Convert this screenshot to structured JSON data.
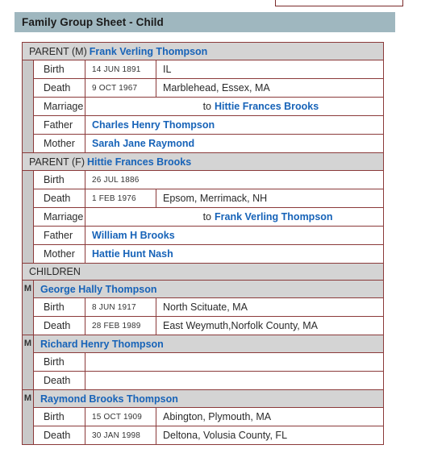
{
  "top_partial_box": {
    "visible": true
  },
  "header": {
    "title": "Family Group Sheet - Child"
  },
  "labels": {
    "birth": "Birth",
    "death": "Death",
    "marriage": "Marriage",
    "father": "Father",
    "mother": "Mother",
    "marriage_to": "to",
    "children_heading": "CHILDREN",
    "gender_male": "M"
  },
  "colors": {
    "title_bar": "#9fb7bf",
    "row_header_gray": "#d4d4d4",
    "gutter_gray": "#c9c9c9",
    "border_red": "#8b3a3a",
    "link_blue": "#1763b8",
    "text_dark": "#2a2a2a"
  },
  "parents": [
    {
      "role": "PARENT (M)",
      "name": "Frank Verling Thompson",
      "birth": {
        "date": "14 JUN 1891",
        "place": "IL"
      },
      "death": {
        "date": "9 OCT 1967",
        "place": "Marblehead, Essex, MA"
      },
      "marriage": {
        "spouse": "Hittie Frances Brooks"
      },
      "father": "Charles Henry Thompson",
      "mother": "Sarah Jane Raymond"
    },
    {
      "role": "PARENT (F)",
      "name": "Hittie Frances Brooks",
      "birth": {
        "date": "26 JUL 1886",
        "place": ""
      },
      "death": {
        "date": "1 FEB 1976",
        "place": "Epsom, Merrimack, NH"
      },
      "marriage": {
        "spouse": "Frank Verling Thompson"
      },
      "father": "William H Brooks",
      "mother": "Hattie Hunt Nash"
    }
  ],
  "children": [
    {
      "gender": "M",
      "name": "George Hally Thompson",
      "birth": {
        "date": "8 JUN 1917",
        "place": "North Scituate, MA"
      },
      "death": {
        "date": "28 FEB 1989",
        "place": "East Weymuth,Norfolk County, MA"
      }
    },
    {
      "gender": "M",
      "name": "Richard Henry Thompson",
      "birth": {
        "date": "",
        "place": ""
      },
      "death": {
        "date": "",
        "place": ""
      }
    },
    {
      "gender": "M",
      "name": "Raymond Brooks Thompson",
      "birth": {
        "date": "15 OCT 1909",
        "place": "Abington, Plymouth, MA"
      },
      "death": {
        "date": "30 JAN 1998",
        "place": "Deltona, Volusia County, FL"
      }
    }
  ]
}
